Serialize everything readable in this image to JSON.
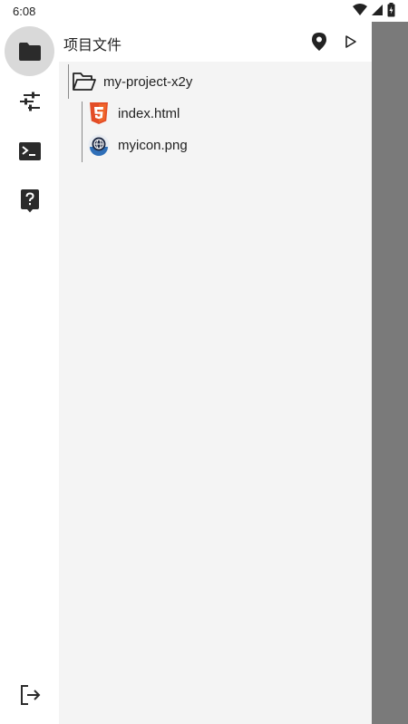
{
  "status_bar": {
    "time": "6:08"
  },
  "rail": {
    "items": [
      {
        "icon": "folder-icon",
        "active": true
      },
      {
        "icon": "sliders-icon",
        "active": false
      },
      {
        "icon": "terminal-icon",
        "active": false
      },
      {
        "icon": "help-icon",
        "active": false
      }
    ],
    "bottom_icon": "logout-icon"
  },
  "panel": {
    "title": "项目文件",
    "header_actions": [
      "location-pin-icon",
      "play-icon"
    ]
  },
  "tree": {
    "root": {
      "name": "my-project-x2y",
      "icon": "folder-open-icon"
    },
    "children": [
      {
        "name": "index.html",
        "icon": "html5-icon"
      },
      {
        "name": "myicon.png",
        "icon": "image-globe-icon"
      }
    ]
  },
  "colors": {
    "scrim": "#7a7a7a",
    "panel_bg": "#f4f4f4",
    "active_rail": "#d9d9d9",
    "html5": "#e34c26"
  }
}
